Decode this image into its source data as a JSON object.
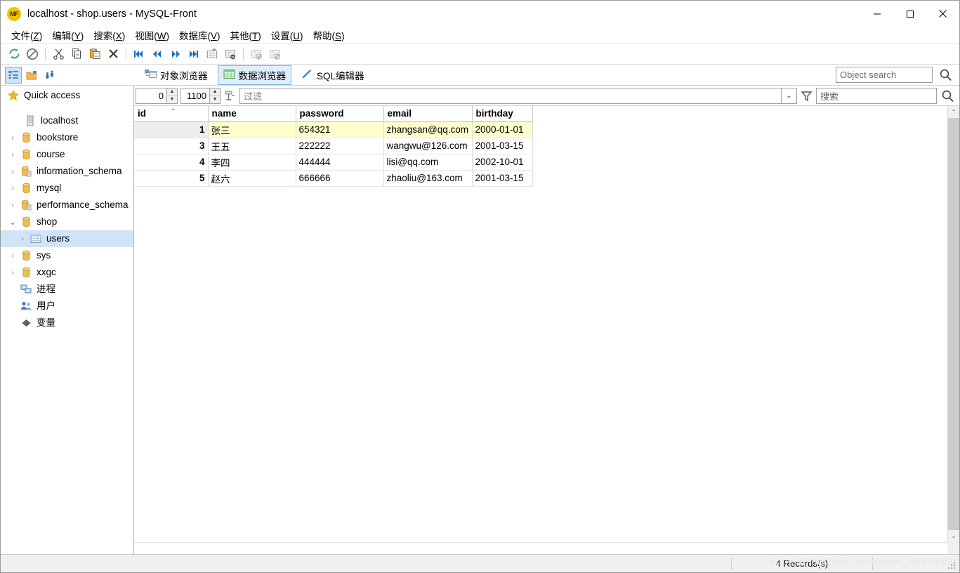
{
  "window": {
    "title": "localhost - shop.users - MySQL-Front",
    "app_badge": "MF",
    "minimize": "—",
    "maximize": "□",
    "close": "✕"
  },
  "menubar": {
    "items": [
      {
        "label": "文件",
        "accel": "Z"
      },
      {
        "label": "编辑",
        "accel": "Y"
      },
      {
        "label": "搜索",
        "accel": "X"
      },
      {
        "label": "视图",
        "accel": "W"
      },
      {
        "label": "数据库",
        "accel": "V"
      },
      {
        "label": "其他",
        "accel": "T"
      },
      {
        "label": "设置",
        "accel": "U"
      },
      {
        "label": "帮助",
        "accel": "S"
      }
    ]
  },
  "toolbar": {
    "buttons": [
      {
        "name": "refresh-icon",
        "tip": "刷新"
      },
      {
        "name": "stop-icon",
        "tip": "停止"
      },
      {
        "name": "cut-icon",
        "tip": "剪切"
      },
      {
        "name": "copy-icon",
        "tip": "复制"
      },
      {
        "name": "paste-icon",
        "tip": "粘贴"
      },
      {
        "name": "delete-icon",
        "tip": "删除"
      },
      {
        "name": "first-record-icon",
        "tip": "第一条"
      },
      {
        "name": "prev-record-icon",
        "tip": "上一条"
      },
      {
        "name": "next-record-icon",
        "tip": "下一条"
      },
      {
        "name": "last-record-icon",
        "tip": "最后一条"
      },
      {
        "name": "insert-row-icon",
        "tip": "插入行"
      },
      {
        "name": "delete-row-icon",
        "tip": "删除行"
      },
      {
        "name": "commit-icon",
        "tip": "提交"
      },
      {
        "name": "rollback-icon",
        "tip": "回滚"
      }
    ]
  },
  "tabs": {
    "left_buttons": [
      {
        "name": "tree-view-icon",
        "selected": true
      },
      {
        "name": "folder-view-icon",
        "selected": false
      },
      {
        "name": "footsteps-icon",
        "selected": false
      }
    ],
    "items": [
      {
        "label": "对象浏览器",
        "icon": "object-browser-icon",
        "active": false
      },
      {
        "label": "数据浏览器",
        "icon": "data-browser-icon",
        "active": true
      },
      {
        "label": "SQL编辑器",
        "icon": "sql-editor-icon",
        "active": false
      }
    ],
    "object_search_placeholder": "Object search",
    "object_search_value": ""
  },
  "sidebar": {
    "quick_access": {
      "label": "Quick access",
      "icon": "star-icon"
    },
    "items": [
      {
        "label": "localhost",
        "icon": "server-icon",
        "indent": 0,
        "twisty": "",
        "selected": false
      },
      {
        "label": "bookstore",
        "icon": "database-icon",
        "indent": 1,
        "twisty": "›",
        "selected": false
      },
      {
        "label": "course",
        "icon": "database-icon",
        "indent": 1,
        "twisty": "›",
        "selected": false
      },
      {
        "label": "information_schema",
        "icon": "database-system-icon",
        "indent": 1,
        "twisty": "›",
        "selected": false
      },
      {
        "label": "mysql",
        "icon": "database-icon",
        "indent": 1,
        "twisty": "›",
        "selected": false
      },
      {
        "label": "performance_schema",
        "icon": "database-system-icon",
        "indent": 1,
        "twisty": "›",
        "selected": false
      },
      {
        "label": "shop",
        "icon": "database-icon",
        "indent": 1,
        "twisty": "⌄",
        "selected": false
      },
      {
        "label": "users",
        "icon": "table-icon",
        "indent": 2,
        "twisty": "›",
        "selected": true
      },
      {
        "label": "sys",
        "icon": "database-icon",
        "indent": 1,
        "twisty": "›",
        "selected": false
      },
      {
        "label": "xxgc",
        "icon": "database-icon",
        "indent": 1,
        "twisty": "›",
        "selected": false
      },
      {
        "label": "进程",
        "icon": "processes-icon",
        "indent": 1,
        "twisty": "",
        "selected": false
      },
      {
        "label": "用户",
        "icon": "users-icon",
        "indent": 1,
        "twisty": "",
        "selected": false
      },
      {
        "label": "变量",
        "icon": "variables-icon",
        "indent": 1,
        "twisty": "",
        "selected": false
      }
    ]
  },
  "filterbar": {
    "offset_value": "0",
    "limit_value": "1100",
    "limit_icon": "limit-rows-icon",
    "filter_placeholder": "过滤",
    "filter_value": "",
    "dropdown_icon": "chevron-down-icon",
    "funnel_icon": "funnel-icon",
    "search_placeholder": "搜索",
    "search_value": "",
    "search_icon": "magnifier-icon"
  },
  "grid": {
    "columns": [
      "id",
      "name",
      "password",
      "email",
      "birthday"
    ],
    "sort_column": "id",
    "sort_direction": "asc",
    "rows": [
      {
        "id": "1",
        "name": "张三",
        "password": "654321",
        "email": "zhangsan@qq.com",
        "birthday": "2000-01-01",
        "highlighted": true
      },
      {
        "id": "3",
        "name": "王五",
        "password": "222222",
        "email": "wangwu@126.com",
        "birthday": "2001-03-15",
        "highlighted": false
      },
      {
        "id": "4",
        "name": "李四",
        "password": "444444",
        "email": "lisi@qq.com",
        "birthday": "2002-10-01",
        "highlighted": false
      },
      {
        "id": "5",
        "name": "赵六",
        "password": "666666",
        "email": "zhaoliu@163.com",
        "birthday": "2001-03-15",
        "highlighted": false
      }
    ]
  },
  "statusbar": {
    "record_count": "4 Records(s)",
    "watermark": "https://blog.csdn.net/weixin_48874360"
  }
}
